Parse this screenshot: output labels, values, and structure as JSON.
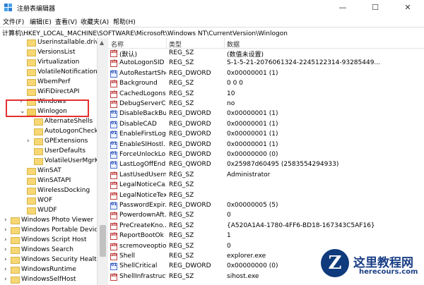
{
  "window": {
    "title": "注册表编辑器",
    "minimize": "—",
    "maximize": "☐",
    "close": "✕"
  },
  "menu": [
    "文件(F)",
    "编辑(E)",
    "查看(V)",
    "收藏夹(A)",
    "帮助(H)"
  ],
  "address": "计算机\\HKEY_LOCAL_MACHINE\\SOFTWARE\\Microsoft\\Windows NT\\CurrentVersion\\Winlogon",
  "tree": [
    {
      "label": "Userinstallable.driver",
      "arrow": ""
    },
    {
      "label": "VersionsList",
      "arrow": ""
    },
    {
      "label": "Virtualization",
      "arrow": ""
    },
    {
      "label": "VolatileNotifications",
      "arrow": ""
    },
    {
      "label": "WbemPerf",
      "arrow": ""
    },
    {
      "label": "WiFiDirectAPI",
      "arrow": ""
    },
    {
      "label": "Windows",
      "arrow": "›"
    },
    {
      "label": "Winlogon",
      "arrow": "⌄"
    },
    {
      "label": "AlternateShells",
      "arrow": ""
    },
    {
      "label": "AutoLogonChecke",
      "arrow": ""
    },
    {
      "label": "GPExtensions",
      "arrow": "›"
    },
    {
      "label": "UserDefaults",
      "arrow": ""
    },
    {
      "label": "VolatileUserMgrK",
      "arrow": ""
    },
    {
      "label": "WinSAT",
      "arrow": ""
    },
    {
      "label": "WinSATAPI",
      "arrow": ""
    },
    {
      "label": "WirelessDocking",
      "arrow": ""
    },
    {
      "label": "WOF",
      "arrow": ""
    },
    {
      "label": "WUDF",
      "arrow": ""
    },
    {
      "label": "Windows Photo Viewer",
      "arrow": "›"
    },
    {
      "label": "Windows Portable Devices",
      "arrow": "›"
    },
    {
      "label": "Windows Script Host",
      "arrow": "›"
    },
    {
      "label": "Windows Search",
      "arrow": "›"
    },
    {
      "label": "Windows Security Health",
      "arrow": "›"
    },
    {
      "label": "WindowsRuntime",
      "arrow": "›"
    },
    {
      "label": "WindowsSelfHost",
      "arrow": "›"
    }
  ],
  "columns": {
    "name": "名称",
    "type": "类型",
    "data": "数据"
  },
  "values": [
    {
      "name": "(默认)",
      "type": "REG_SZ",
      "data": "(数值未设置)",
      "kind": "sz"
    },
    {
      "name": "AutoLogonSID",
      "type": "REG_SZ",
      "data": "S-1-5-21-2076061324-2245122314-93285449...",
      "kind": "sz"
    },
    {
      "name": "AutoRestartShell",
      "type": "REG_DWORD",
      "data": "0x00000001 (1)",
      "kind": "dw"
    },
    {
      "name": "Background",
      "type": "REG_SZ",
      "data": "0 0 0",
      "kind": "sz"
    },
    {
      "name": "CachedLogons...",
      "type": "REG_SZ",
      "data": "10",
      "kind": "sz"
    },
    {
      "name": "DebugServerC...",
      "type": "REG_SZ",
      "data": "no",
      "kind": "sz"
    },
    {
      "name": "DisableBackBu...",
      "type": "REG_DWORD",
      "data": "0x00000001 (1)",
      "kind": "dw"
    },
    {
      "name": "DisableCAD",
      "type": "REG_DWORD",
      "data": "0x00000001 (1)",
      "kind": "dw"
    },
    {
      "name": "EnableFirstLog...",
      "type": "REG_DWORD",
      "data": "0x00000001 (1)",
      "kind": "dw"
    },
    {
      "name": "EnableSIHostl...",
      "type": "REG_DWORD",
      "data": "0x00000001 (1)",
      "kind": "dw"
    },
    {
      "name": "ForceUnlockLo...",
      "type": "REG_DWORD",
      "data": "0x00000000 (0)",
      "kind": "dw"
    },
    {
      "name": "LastLogOffEnd...",
      "type": "REG_QWORD",
      "data": "0x25987d60495 (2583554294933)",
      "kind": "dw"
    },
    {
      "name": "LastUsedUsern...",
      "type": "REG_SZ",
      "data": "Administrator",
      "kind": "sz"
    },
    {
      "name": "LegalNoticeCa...",
      "type": "REG_SZ",
      "data": "",
      "kind": "sz"
    },
    {
      "name": "LegalNoticeText",
      "type": "REG_SZ",
      "data": "",
      "kind": "sz"
    },
    {
      "name": "PasswordExpir...",
      "type": "REG_DWORD",
      "data": "0x00000005 (5)",
      "kind": "dw"
    },
    {
      "name": "PowerdownAft...",
      "type": "REG_SZ",
      "data": "0",
      "kind": "sz"
    },
    {
      "name": "PreCreateKno...",
      "type": "REG_SZ",
      "data": "{A520A1A4-1780-4FF6-BD18-167343C5AF16}",
      "kind": "sz"
    },
    {
      "name": "ReportBootOk",
      "type": "REG_SZ",
      "data": "1",
      "kind": "sz"
    },
    {
      "name": "scremoveoption",
      "type": "REG_SZ",
      "data": "0",
      "kind": "sz"
    },
    {
      "name": "Shell",
      "type": "REG_SZ",
      "data": "explorer.exe",
      "kind": "sz"
    },
    {
      "name": "ShellCritical",
      "type": "REG_DWORD",
      "data": "0x00000000 (0)",
      "kind": "dw"
    },
    {
      "name": "ShellInfrastruct...",
      "type": "REG_SZ",
      "data": "sihost.exe",
      "kind": "sz"
    }
  ],
  "watermark": {
    "logo": "Z",
    "title": "这里教程网",
    "url": "herecours.com"
  }
}
